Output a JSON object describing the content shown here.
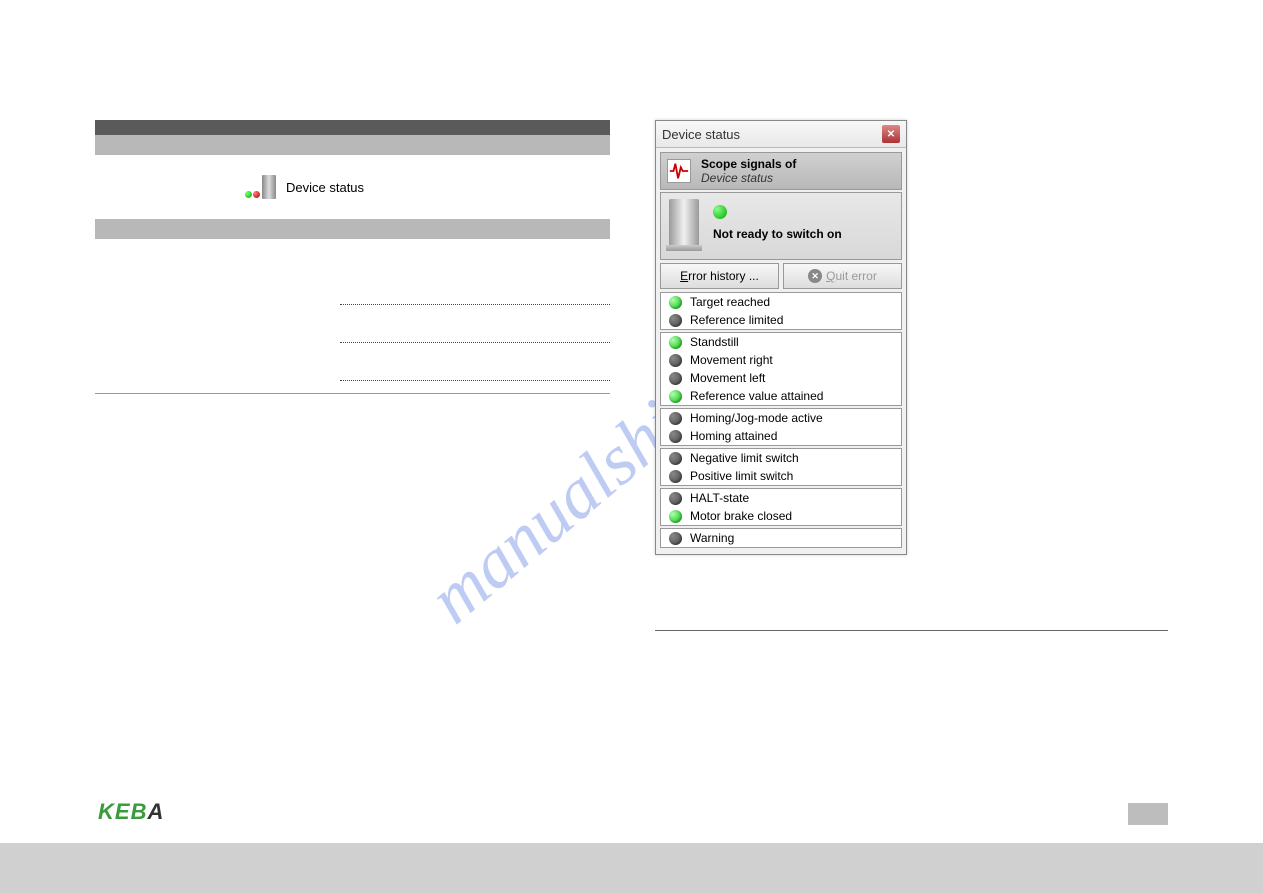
{
  "watermark": "manualshive.com",
  "leftPanel": {
    "iconLabel": "Device status"
  },
  "window": {
    "title": "Device status",
    "scopeHeader": {
      "line1": "Scope signals of",
      "line2": "Device status"
    },
    "statusText": "Not ready to switch on",
    "buttons": {
      "errorHistoryPrefix": "E",
      "errorHistoryRest": "rror history ...",
      "quitErrorPrefix": "Q",
      "quitErrorRest": "uit error"
    },
    "groups": [
      {
        "items": [
          {
            "label": "Target reached",
            "state": "on"
          },
          {
            "label": "Reference limited",
            "state": "off"
          }
        ]
      },
      {
        "items": [
          {
            "label": "Standstill",
            "state": "on"
          },
          {
            "label": "Movement right",
            "state": "off"
          },
          {
            "label": "Movement left",
            "state": "off"
          },
          {
            "label": "Reference value attained",
            "state": "on"
          }
        ]
      },
      {
        "items": [
          {
            "label": "Homing/Jog-mode active",
            "state": "off"
          },
          {
            "label": "Homing attained",
            "state": "off"
          }
        ]
      },
      {
        "items": [
          {
            "label": "Negative limit switch",
            "state": "off"
          },
          {
            "label": "Positive limit switch",
            "state": "off"
          }
        ]
      },
      {
        "items": [
          {
            "label": "HALT-state",
            "state": "off"
          },
          {
            "label": "Motor brake closed",
            "state": "on"
          }
        ]
      },
      {
        "items": [
          {
            "label": "Warning",
            "state": "off"
          }
        ]
      }
    ]
  },
  "logo": {
    "k": "K",
    "e": "E",
    "b": "B",
    "a": "A"
  }
}
